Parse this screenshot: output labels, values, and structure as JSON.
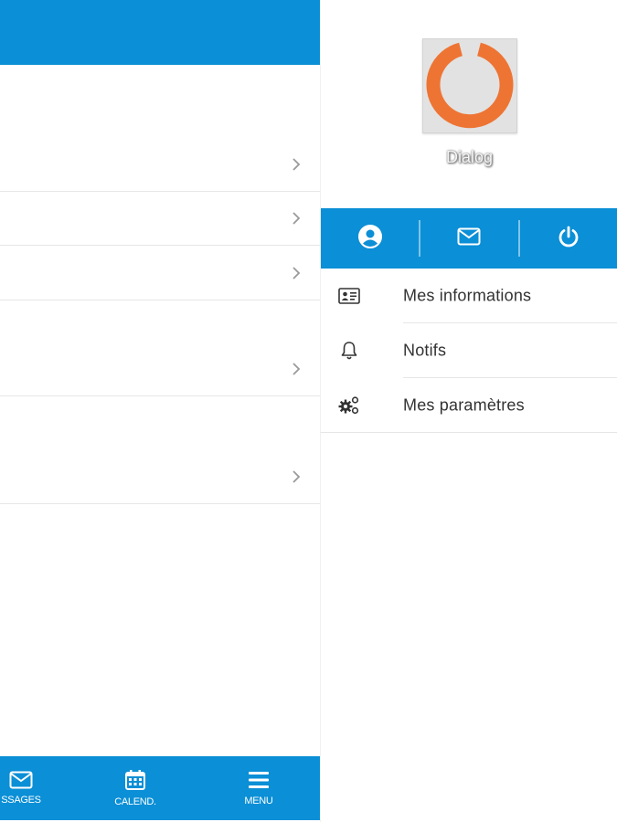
{
  "main": {
    "bottom_nav": [
      {
        "label": "SSAGES",
        "icon": "envelope-icon"
      },
      {
        "label": "CALEND.",
        "icon": "calendar-icon"
      },
      {
        "label": "MENU",
        "icon": "menu-icon"
      }
    ]
  },
  "drawer": {
    "org_name": "Dialog",
    "logo": "dialog-logo-icon",
    "actions": [
      {
        "icon": "user-circle-icon"
      },
      {
        "icon": "envelope-icon"
      },
      {
        "icon": "power-icon"
      }
    ],
    "menu": [
      {
        "label": "Mes informations",
        "icon": "id-card-icon"
      },
      {
        "label": "Notifs",
        "icon": "bell-icon"
      },
      {
        "label": "Mes paramètres",
        "icon": "gears-icon"
      }
    ]
  },
  "colors": {
    "primary": "#0b8fd6",
    "logo_orange": "#ee7433",
    "text": "#333333"
  }
}
